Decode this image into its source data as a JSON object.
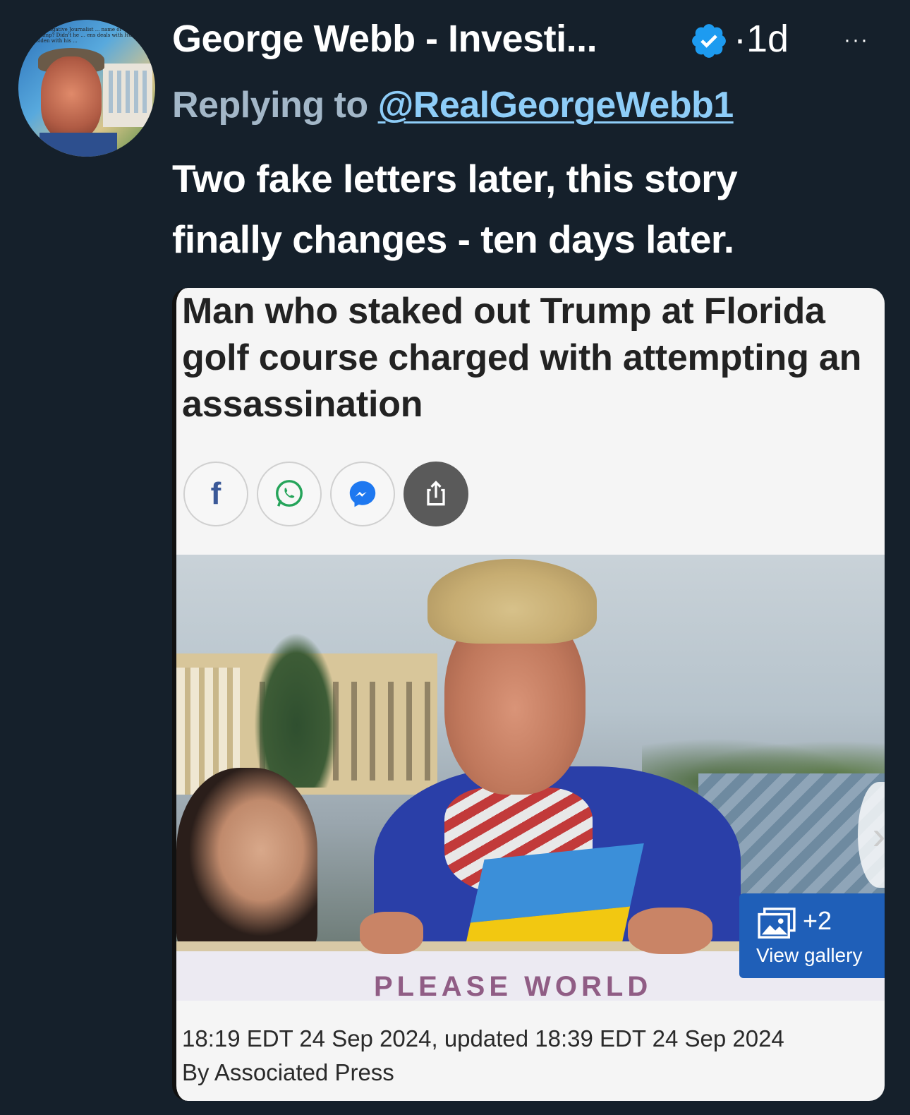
{
  "tweet": {
    "author_name": "George Webb - Investi...",
    "separator": "·",
    "time_ago": "1d",
    "more_label": "···",
    "reply_prefix": "Replying to",
    "reply_handle": "@RealGeorgeWebb1",
    "text_line1": "Two fake letters later, this story",
    "text_line2": "finally changes - ten days later.",
    "avatar_caption": "Investigative Journalist ... name of Yu to Trump? Didn't he ... ens deals with Hunter Biden with his ...",
    "verified_color": "#1d9bf0",
    "link_color": "#8ecdf8"
  },
  "card": {
    "headline": "Man who staked out Trump at Florida golf course charged with attempting an assassination",
    "share_buttons": [
      {
        "icon": "facebook-icon",
        "glyph": "f"
      },
      {
        "icon": "whatsapp-icon"
      },
      {
        "icon": "messenger-icon"
      },
      {
        "icon": "share-icon"
      }
    ],
    "gallery_count": "+2",
    "gallery_label": "View gallery",
    "board_text": "PLEASE   WORLD",
    "timestamp": "18:19 EDT 24 Sep 2024, updated 18:39 EDT 24 Sep 2024",
    "byline": "By Associated Press",
    "accent": "#1f5fb8"
  }
}
